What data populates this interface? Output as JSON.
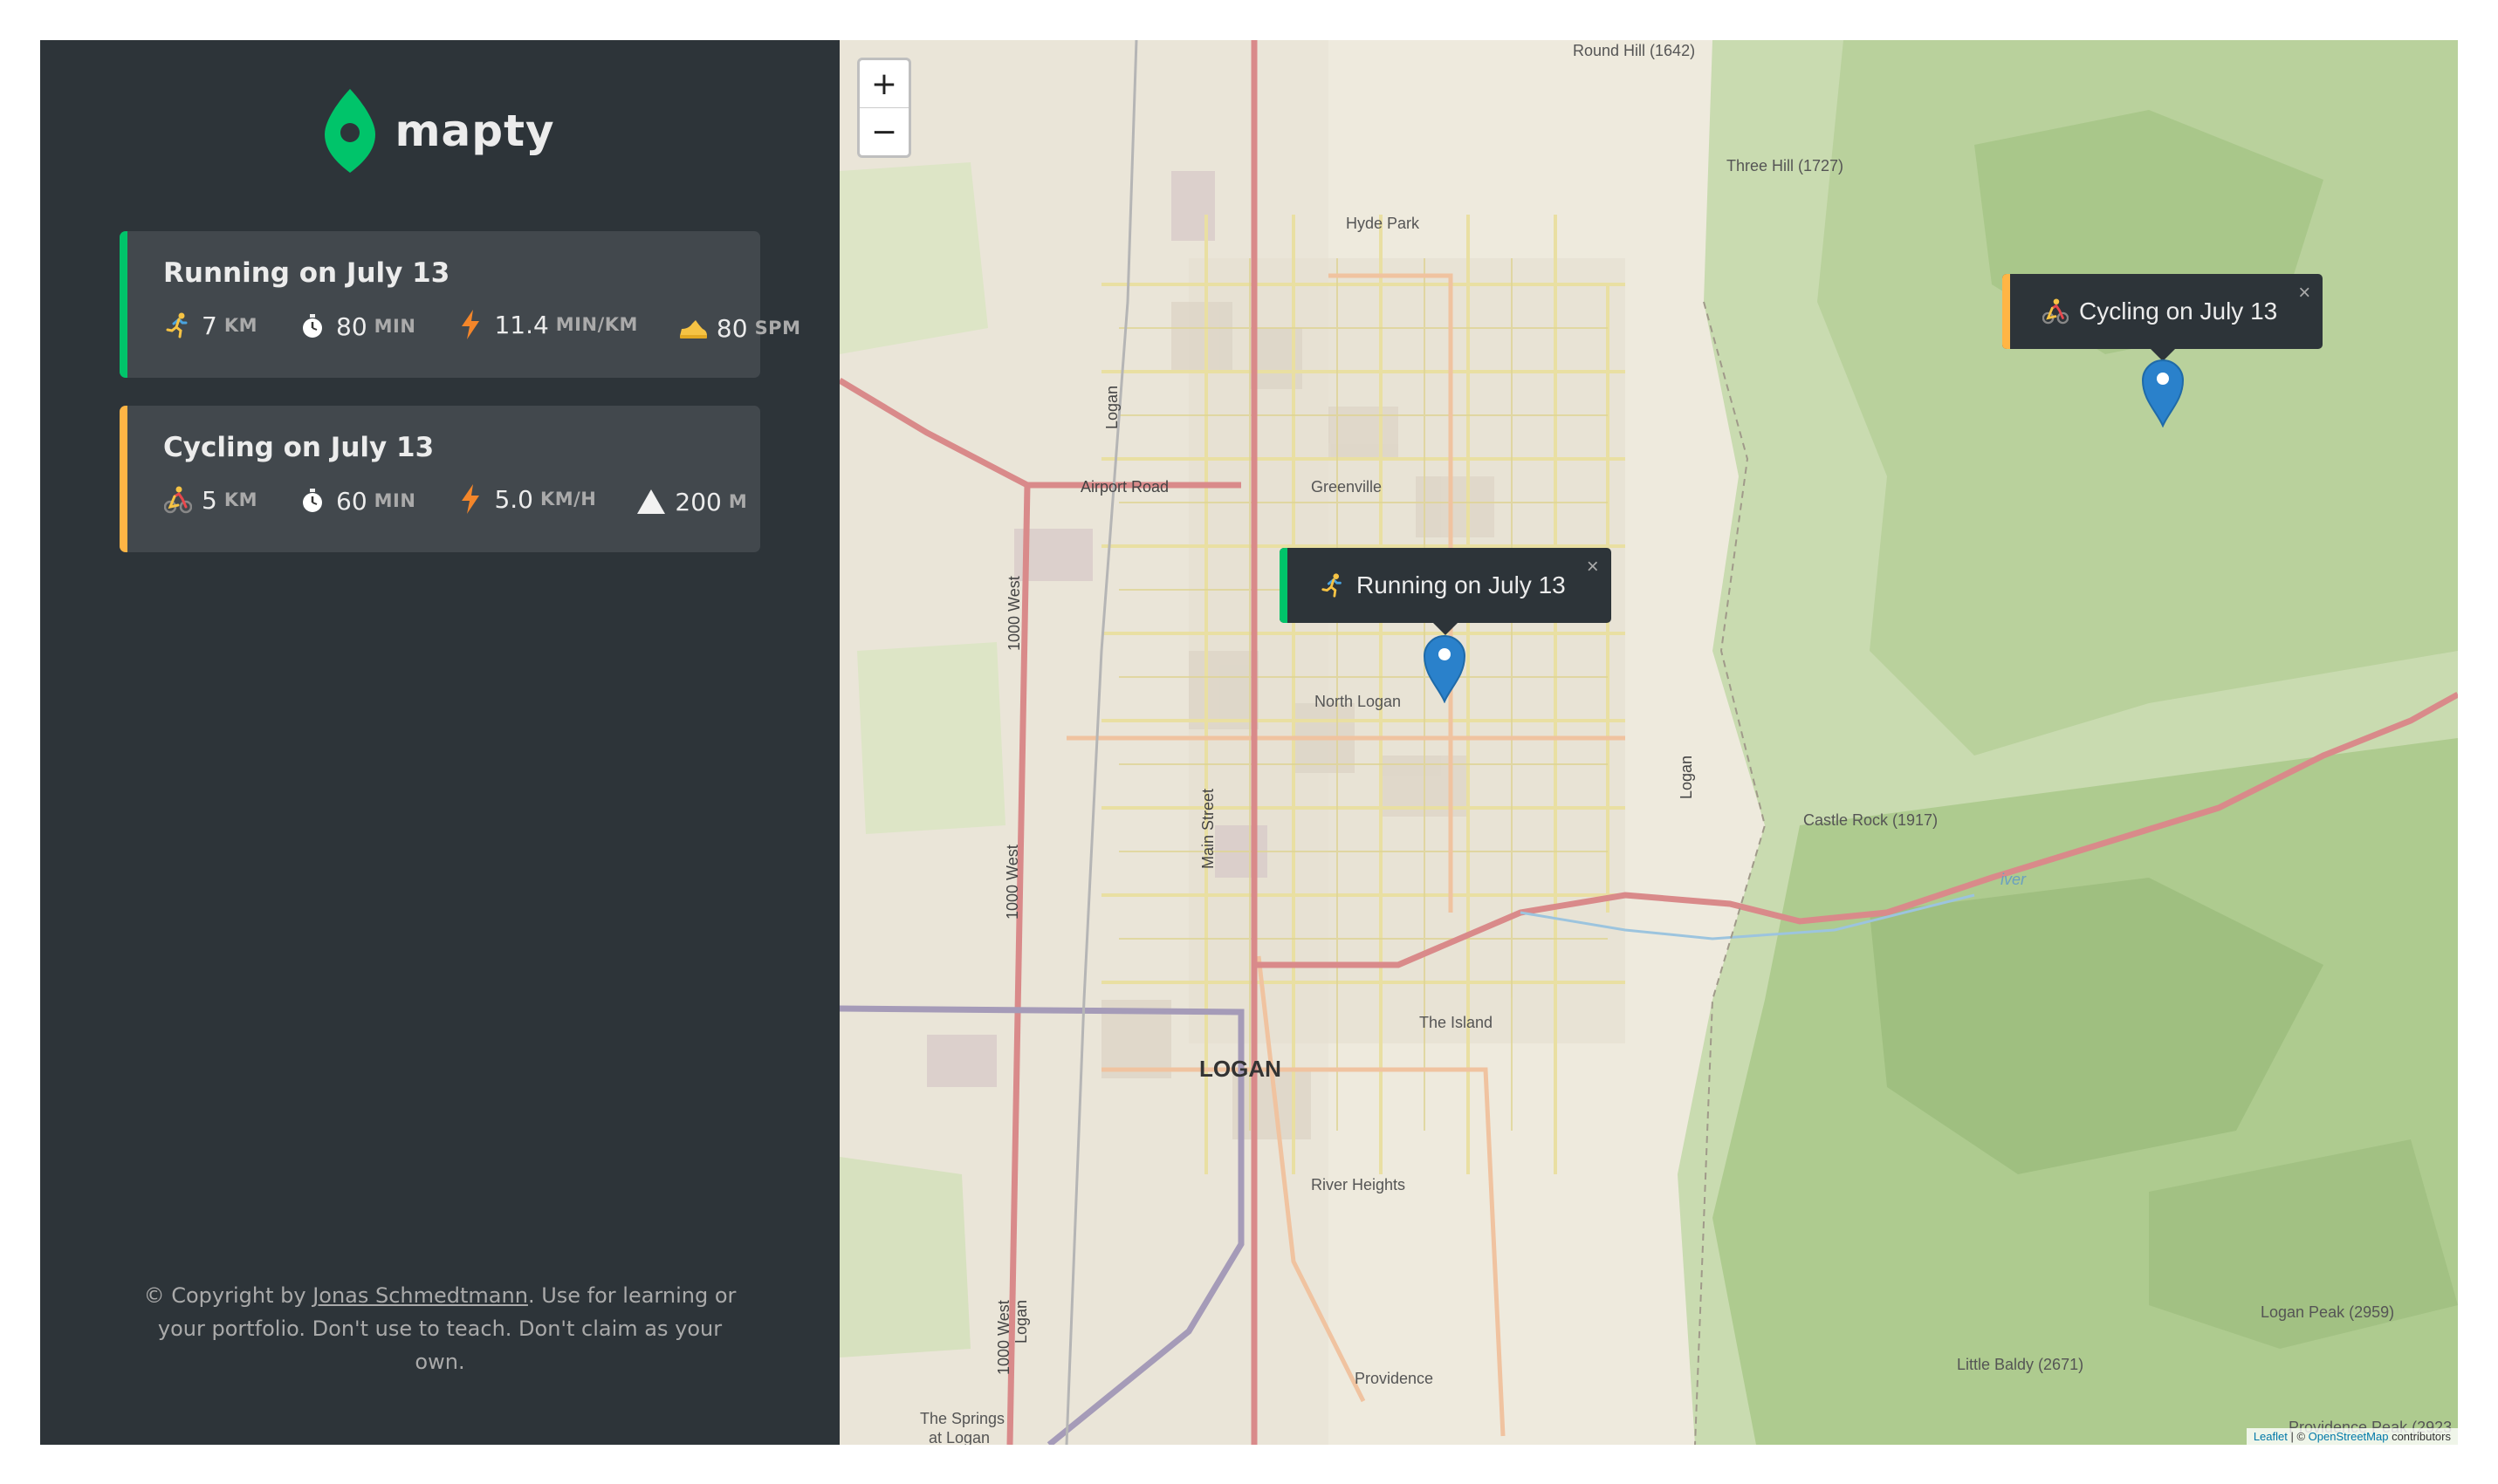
{
  "brand": {
    "name": "mapty",
    "accent_green": "#00c46a",
    "accent_yellow": "#ffb545"
  },
  "workouts": [
    {
      "type": "running",
      "title": "Running on July 13",
      "details": [
        {
          "icon": "running-icon",
          "value": "7",
          "unit": "km"
        },
        {
          "icon": "stopwatch-icon",
          "value": "80",
          "unit": "min"
        },
        {
          "icon": "lightning-icon",
          "value": "11.4",
          "unit": "min/km"
        },
        {
          "icon": "shoe-icon",
          "value": "80",
          "unit": "spm"
        }
      ]
    },
    {
      "type": "cycling",
      "title": "Cycling on July 13",
      "details": [
        {
          "icon": "cycling-icon",
          "value": "5",
          "unit": "km"
        },
        {
          "icon": "stopwatch-icon",
          "value": "60",
          "unit": "min"
        },
        {
          "icon": "lightning-icon",
          "value": "5.0",
          "unit": "km/h"
        },
        {
          "icon": "mountain-icon",
          "value": "200",
          "unit": "m"
        }
      ]
    }
  ],
  "copyright": {
    "prefix": "© Copyright by ",
    "author": "Jonas Schmedtmann",
    "suffix": ". Use for learning or your portfolio. Don't use to teach. Don't claim as your own."
  },
  "map": {
    "zoom_in": "+",
    "zoom_out": "−",
    "popups": {
      "running": "Running on July 13",
      "cycling": "Cycling on July 13",
      "close": "×"
    },
    "labels": {
      "round_hill": "Round Hill (1642)",
      "three_hill": "Three Hill (1727)",
      "hyde_park": "Hyde Park",
      "airport_road": "Airport Road",
      "greenville": "Greenville",
      "north_logan": "North Logan",
      "logan_city": "LOGAN",
      "main_street": "Main Street",
      "west_1000_a": "1000 West",
      "west_1000_b": "1000 West",
      "west_1000_c": "1000 West",
      "logan_a": "Logan",
      "logan_b": "Logan",
      "logan_c": "Logan",
      "castle_rock": "Castle Rock (1917)",
      "the_island": "The Island",
      "river_heights": "River Heights",
      "providence": "Providence",
      "logan_peak": "Logan Peak (2959)",
      "little_baldy": "Little Baldy (2671)",
      "the_springs": "The Springs",
      "at_logan": "at Logan",
      "providence_peak": "Providence Peak (2923",
      "river": "iver"
    },
    "attribution": {
      "leaflet": "Leaflet",
      "sep": " | © ",
      "osm": "OpenStreetMap",
      "suffix": " contributors"
    }
  }
}
